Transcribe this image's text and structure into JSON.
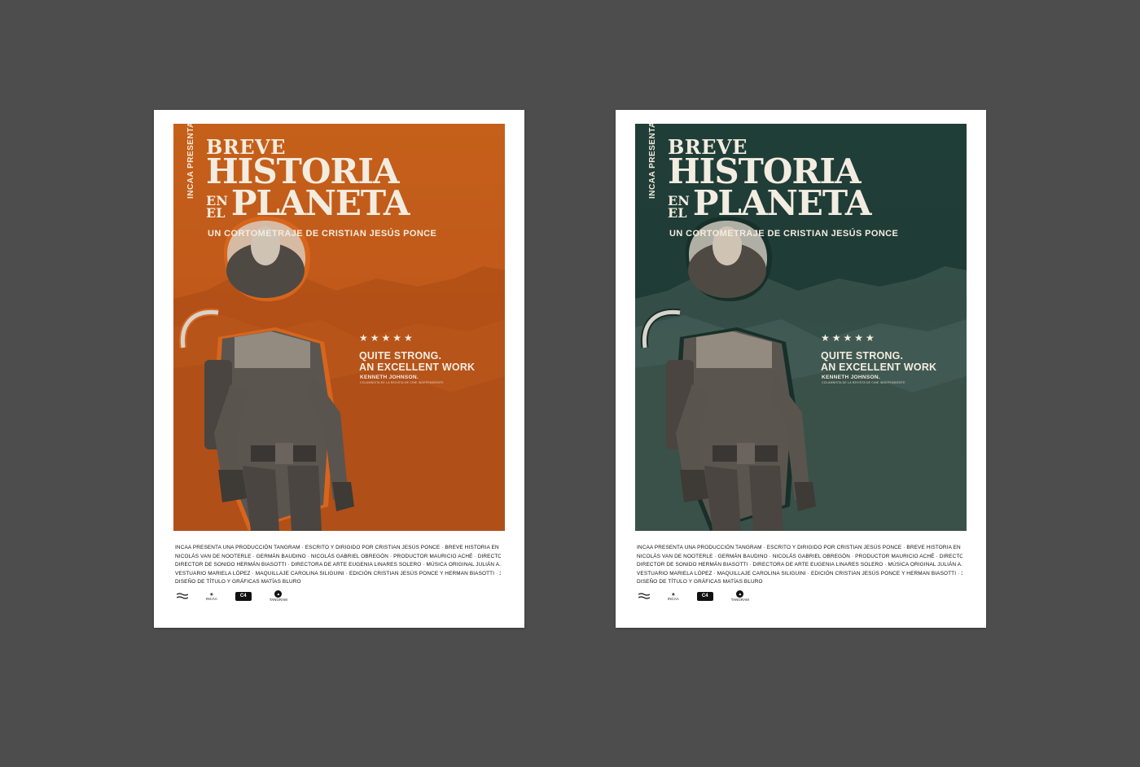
{
  "posters": [
    {
      "variant": "orange",
      "presenter": "INCAA PRESENTA",
      "title_line1": "BREVE",
      "title_line2": "HISTORIA",
      "title_en": "EN",
      "title_el": "EL",
      "title_line3": "PLANETA",
      "subtitle": "UN CORTOMETRAJE DE CRISTIAN JESÚS PONCE",
      "stars": "★★★★★",
      "quote_line1": "QUITE STRONG.",
      "quote_line2": "AN EXCELLENT WORK",
      "reviewer": "KENNETH JOHNSON.",
      "reviewer_detail": "COLUMNISTA DE LA REVISTA DE CINE INDEPENDIENTE",
      "credits": [
        "INCAA PRESENTA UNA PRODUCCIÓN TANGRAM · ESCRITO Y DIRIGIDO POR CRISTIAN JESÚS PONCE · BREVE HISTORIA EN EL PLANETA",
        "NICOLÁS VAN DE NOOTERLE · GERMÁN BAUDINO · NICOLÁS GABRIEL OBREGÓN · PRODUCTOR MAURICIO ACHÉ · DIRECTOR DE FOTOGRAFÍA MATÍAS FABRO",
        "DIRECTOR DE SONIDO HERMÁN BIASOTTI · DIRECTORA DE ARTE EUGENIA LINARES SOLERO · MÚSICA ORIGINAL JULIÁN A. RODRÍGUEZ",
        "VESTUARIO MARIELA LÓPEZ · MAQUILLAJE CAROLINA SILIGUINI · EDICIÓN CRISTIAN JESÚS PONCE Y HERMAN BIASOTTI · 3D Y VFX HUESO",
        "DISEÑO DE TÍTULO Y GRÁFICAS MATÍAS BLURO"
      ],
      "logo_labels": [
        "",
        "INCAA",
        "C4",
        "TANGRAM"
      ],
      "colors": {
        "bg": "#c25a1a",
        "glow": "#d8651c"
      }
    },
    {
      "variant": "green",
      "presenter": "INCAA PRESENTA",
      "title_line1": "BREVE",
      "title_line2": "HISTORIA",
      "title_en": "EN",
      "title_el": "EL",
      "title_line3": "PLANETA",
      "subtitle": "UN CORTOMETRAJE DE CRISTIAN JESÚS PONCE",
      "stars": "★★★★★",
      "quote_line1": "QUITE STRONG.",
      "quote_line2": "AN EXCELLENT WORK",
      "reviewer": "KENNETH JOHNSON.",
      "reviewer_detail": "COLUMNISTA DE LA REVISTA DE CINE INDEPENDIENTE",
      "credits": [
        "INCAA PRESENTA UNA PRODUCCIÓN TANGRAM · ESCRITO Y DIRIGIDO POR CRISTIAN JESÚS PONCE · BREVE HISTORIA EN EL PLANETA",
        "NICOLÁS VAN DE NOOTERLE · GERMÁN BAUDINO · NICOLÁS GABRIEL OBREGÓN · PRODUCTOR MAURICIO ACHÉ · DIRECTOR DE FOTOGRAFÍA MATÍAS FABRO",
        "DIRECTOR DE SONIDO HERMÁN BIASOTTI · DIRECTORA DE ARTE EUGENIA LINARES SOLERO · MÚSICA ORIGINAL JULIÁN A. RODRÍGUEZ",
        "VESTUARIO MARIELA LÓPEZ · MAQUILLAJE CAROLINA SILIGUINI · EDICIÓN CRISTIAN JESÚS PONCE Y HERMAN BIASOTTI · 3D Y VFX HUESO",
        "DISEÑO DE TÍTULO Y GRÁFICAS MATÍAS BLURO"
      ],
      "logo_labels": [
        "",
        "INCAA",
        "C4",
        "TANGRAM"
      ],
      "colors": {
        "bg": "#1f3c36",
        "glow": "#173029"
      }
    }
  ]
}
